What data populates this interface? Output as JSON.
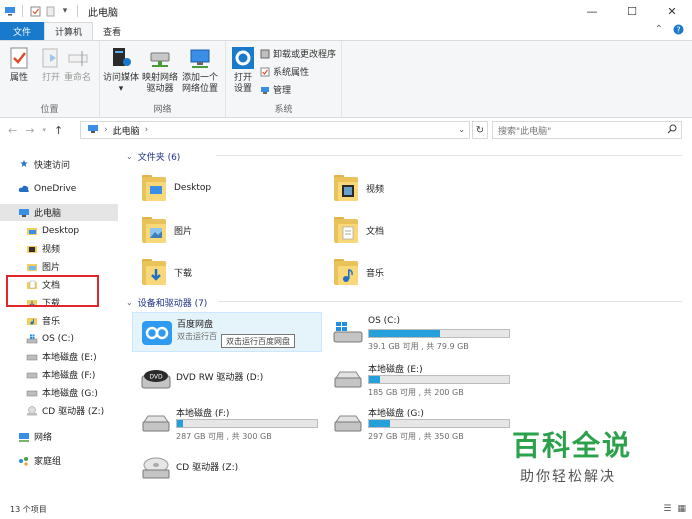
{
  "window": {
    "title": "此电脑"
  },
  "tabs": [
    "文件",
    "计算机",
    "查看"
  ],
  "ribbon": {
    "location_group": {
      "label": "位置",
      "buttons": [
        "属性",
        "打开",
        "重命名"
      ]
    },
    "network_group": {
      "label": "网络",
      "buttons": [
        "访问媒体",
        "映射网络\n驱动器",
        "添加一个\n网络位置"
      ],
      "btn1_line1": "访问媒体",
      "btn2_line1": "映射网络",
      "btn2_line2": "驱动器",
      "btn3_line1": "添加一个",
      "btn3_line2": "网络位置"
    },
    "system_group": {
      "label": "系统",
      "open_settings_line1": "打开",
      "open_settings_line2": "设置",
      "small": [
        "卸载或更改程序",
        "系统属性",
        "管理"
      ]
    }
  },
  "address": {
    "path": "此电脑",
    "search_placeholder": "搜索\"此电脑\""
  },
  "sidebar": {
    "items": [
      {
        "label": "快速访问",
        "icon": "star-icon"
      },
      {
        "label": "OneDrive",
        "icon": "cloud-icon"
      },
      {
        "label": "此电脑",
        "icon": "computer-icon"
      },
      {
        "label": "Desktop",
        "icon": "folder-icon"
      },
      {
        "label": "视频",
        "icon": "video-folder-icon"
      },
      {
        "label": "图片",
        "icon": "picture-folder-icon"
      },
      {
        "label": "文档",
        "icon": "document-folder-icon"
      },
      {
        "label": "下载",
        "icon": "download-folder-icon"
      },
      {
        "label": "音乐",
        "icon": "music-folder-icon"
      },
      {
        "label": "OS (C:)",
        "icon": "windows-drive-icon"
      },
      {
        "label": "本地磁盘 (E:)",
        "icon": "drive-icon"
      },
      {
        "label": "本地磁盘 (F:)",
        "icon": "drive-icon"
      },
      {
        "label": "本地磁盘 (G:)",
        "icon": "drive-icon"
      },
      {
        "label": "CD 驱动器 (Z:)",
        "icon": "cd-drive-icon"
      },
      {
        "label": "网络",
        "icon": "network-icon"
      },
      {
        "label": "家庭组",
        "icon": "homegroup-icon"
      }
    ]
  },
  "content": {
    "folders_header": "文件夹 (6)",
    "folders": [
      {
        "name": "Desktop",
        "icon": "desktop-folder-icon"
      },
      {
        "name": "视频",
        "icon": "video-folder-icon"
      },
      {
        "name": "图片",
        "icon": "picture-folder-icon"
      },
      {
        "name": "文档",
        "icon": "document-folder-icon"
      },
      {
        "name": "下载",
        "icon": "download-folder-icon"
      },
      {
        "name": "音乐",
        "icon": "music-folder-icon"
      }
    ],
    "drives_header": "设备和驱动器 (7)",
    "drives": [
      {
        "name": "百度网盘",
        "sub": "双击运行百",
        "icon": "baidu-cloud-icon"
      },
      {
        "name": "OS (C:)",
        "size": "39.1 GB 可用 , 共 79.9 GB",
        "used": 0.51,
        "icon": "windows-drive-icon"
      },
      {
        "name": "DVD RW 驱动器 (D:)",
        "icon": "dvd-drive-icon"
      },
      {
        "name": "本地磁盘 (E:)",
        "size": "185 GB 可用 , 共 200 GB",
        "used": 0.075,
        "icon": "drive-icon"
      },
      {
        "name": "本地磁盘 (F:)",
        "size": "287 GB 可用 , 共 300 GB",
        "used": 0.043,
        "icon": "drive-icon"
      },
      {
        "name": "本地磁盘 (G:)",
        "size": "297 GB 可用 , 共 350 GB",
        "used": 0.151,
        "icon": "drive-icon"
      },
      {
        "name": "CD 驱动器 (Z:)",
        "icon": "cd-drive-icon"
      }
    ],
    "tooltip": "双击运行百度网盘"
  },
  "status": {
    "count": "13 个项目"
  },
  "watermark": {
    "line1": "百科全说",
    "line2": "助你轻松解决"
  },
  "colors": {
    "accent": "#1979ca",
    "highlight": "#e0272c",
    "bar": "#26a0da",
    "watermark": "#2aa14a"
  }
}
